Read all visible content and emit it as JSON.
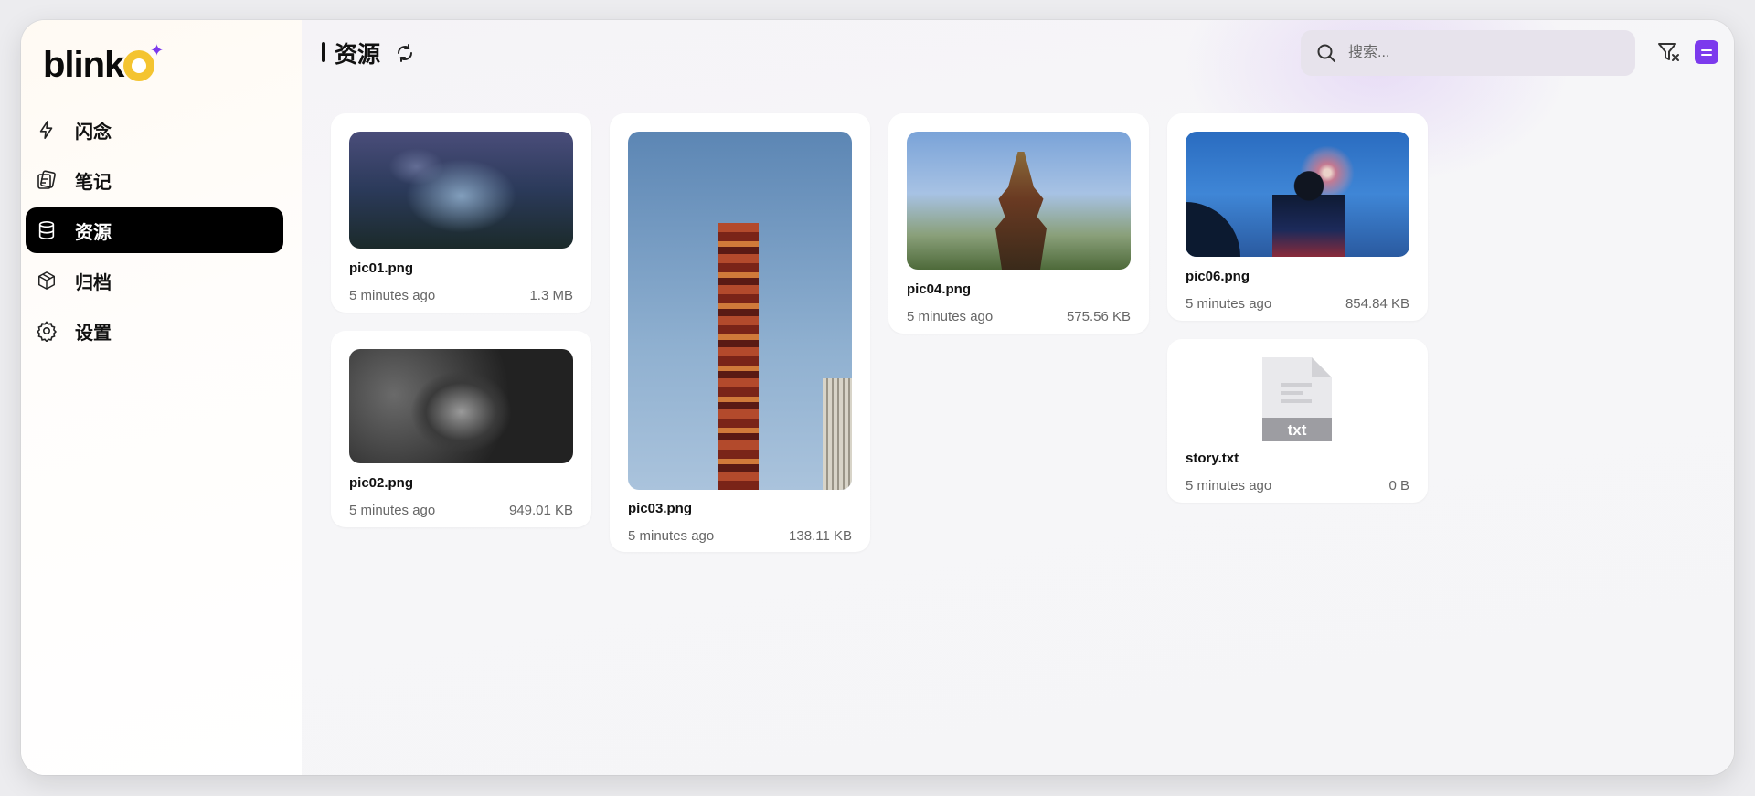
{
  "app": {
    "logo_text": "blink"
  },
  "sidebar": {
    "items": [
      {
        "label": "闪念",
        "icon": "lightning-icon",
        "active": false
      },
      {
        "label": "笔记",
        "icon": "notes-icon",
        "active": false
      },
      {
        "label": "资源",
        "icon": "database-icon",
        "active": true
      },
      {
        "label": "归档",
        "icon": "archive-box-icon",
        "active": false
      },
      {
        "label": "设置",
        "icon": "gear-icon",
        "active": false
      }
    ]
  },
  "header": {
    "title": "资源",
    "search_placeholder": "搜索..."
  },
  "colors": {
    "accent": "#7c3aed",
    "logo_yellow": "#f4c430",
    "active_nav_bg": "#000000"
  },
  "resources": [
    {
      "name": "pic01.png",
      "time": "5 minutes ago",
      "size": "1.3 MB"
    },
    {
      "name": "pic02.png",
      "time": "5 minutes ago",
      "size": "949.01 KB"
    },
    {
      "name": "pic03.png",
      "time": "5 minutes ago",
      "size": "138.11 KB"
    },
    {
      "name": "pic04.png",
      "time": "5 minutes ago",
      "size": "575.56 KB"
    },
    {
      "name": "pic06.png",
      "time": "5 minutes ago",
      "size": "854.84 KB"
    },
    {
      "name": "story.txt",
      "time": "5 minutes ago",
      "size": "0 B",
      "file_type_label": "txt"
    }
  ]
}
